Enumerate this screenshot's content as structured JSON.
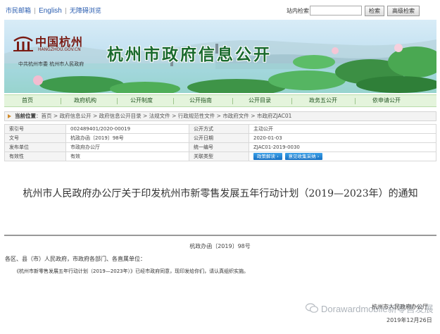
{
  "top": {
    "links": [
      "市民邮箱",
      "English",
      "无障碍浏览"
    ],
    "search_label": "站内检索",
    "search_placeholder": "",
    "search_button": "检索",
    "advanced_button": "高级检索"
  },
  "banner": {
    "logo_cn": "中国杭州",
    "logo_en": "HANGZHOU.GOV.CN",
    "logo_sub": "中共杭州市委 杭州市人民政府",
    "title": "杭州市政府信息公开"
  },
  "nav": [
    "首页",
    "政府机构",
    "公开制度",
    "公开指南",
    "公开目录",
    "政务五公开",
    "依申请公开"
  ],
  "breadcrumb": {
    "here_label": "当前位置",
    "items": [
      "首页",
      "政府信息公开",
      "政府信息公开目录",
      "法规文件",
      "行政规范性文件",
      "市政府文件",
      "市政府ZJAC01"
    ]
  },
  "meta": {
    "rows": [
      {
        "k1": "索引号",
        "v1": "002489401/2020-00019",
        "k2": "公开方式",
        "v2": "主动公开"
      },
      {
        "k1": "文号",
        "v1": "杭政办函〔2019〕98号",
        "k2": "公开日期",
        "v2": "2020-01-03"
      },
      {
        "k1": "发布单位",
        "v1": "市政府办公厅",
        "k2": "统一编号",
        "v2": "ZJAC01-2019-0030"
      },
      {
        "k1": "有效性",
        "v1": "有效",
        "k2": "关联类型",
        "v2": ""
      }
    ],
    "related_buttons": [
      "政策解读 ›",
      "意见收集采纳 ›"
    ]
  },
  "doc": {
    "title": "杭州市人民政府办公厅关于印发杭州市新零售发展五年行动计划（2019—2023年）的通知",
    "number": "杭政办函〔2019〕98号",
    "salutation": "各区、县（市）人民政府，市政府各部门、各直属单位：",
    "body": "《杭州市新零售发展五年行动计划（2019—2023年）》已经市政府同意，现印发给你们，请认真组织实施。",
    "signer": "杭州市人民政府办公厅",
    "date": "2019年12月26日"
  },
  "watermark": "Dorawardmobile新零售发展"
}
